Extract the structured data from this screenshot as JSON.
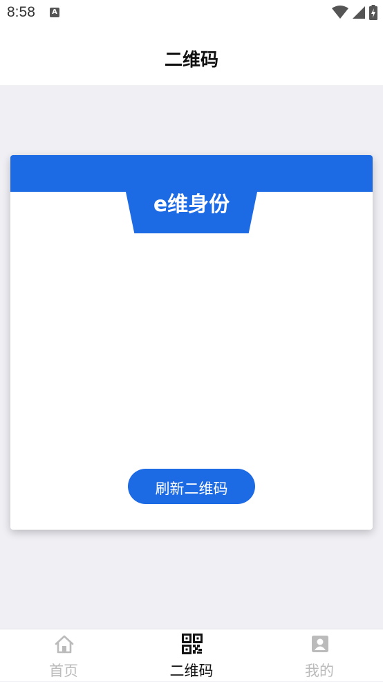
{
  "status_bar": {
    "time": "8:58",
    "notification_icon": "a-letter-icon",
    "icons": [
      "wifi-icon",
      "signal-icon",
      "battery-charging-icon"
    ]
  },
  "header": {
    "title": "二维码"
  },
  "card": {
    "tab_label": "e维身份",
    "refresh_label": "刷新二维码",
    "accent_color": "#1d6ae5"
  },
  "tab_bar": {
    "items": [
      {
        "label": "首页",
        "icon": "home-icon",
        "active": false
      },
      {
        "label": "二维码",
        "icon": "qr-code-icon",
        "active": true
      },
      {
        "label": "我的",
        "icon": "user-profile-icon",
        "active": false
      }
    ],
    "active_color": "#111111",
    "inactive_color": "#bbbbbb"
  }
}
